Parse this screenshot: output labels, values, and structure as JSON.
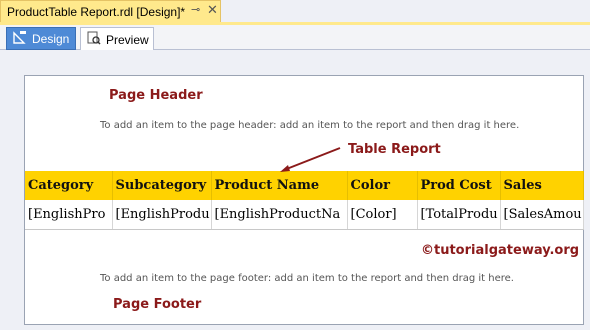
{
  "document_tab": {
    "title": "ProductTable Report.rdl [Design]*",
    "pin_icon": "pin-icon",
    "close_label": "✕"
  },
  "view_tabs": {
    "design_label": "Design",
    "preview_label": "Preview"
  },
  "header": {
    "annotation": "Page Header",
    "hint": "To add an item to the page header: add an item to the report and then drag it here."
  },
  "table_annotation": "Table Report",
  "table": {
    "columns": [
      "Category",
      "Subcategory",
      "Product Name",
      "Color",
      "Prod Cost",
      "Sales"
    ],
    "row": [
      "[EnglishPro",
      "[EnglishProdu",
      "[EnglishProductNa",
      "[Color]",
      "[TotalProdu",
      "[SalesAmou"
    ]
  },
  "footer": {
    "watermark": "©tutorialgateway.org",
    "hint": "To add an item to the page footer: add an item to the report and then drag it here.",
    "annotation": "Page Footer"
  },
  "colors": {
    "header_fill": "#ffd200",
    "annotation": "#8b1a1a",
    "design_tab": "#4e8ad6",
    "doc_tab": "#ffe98c"
  }
}
